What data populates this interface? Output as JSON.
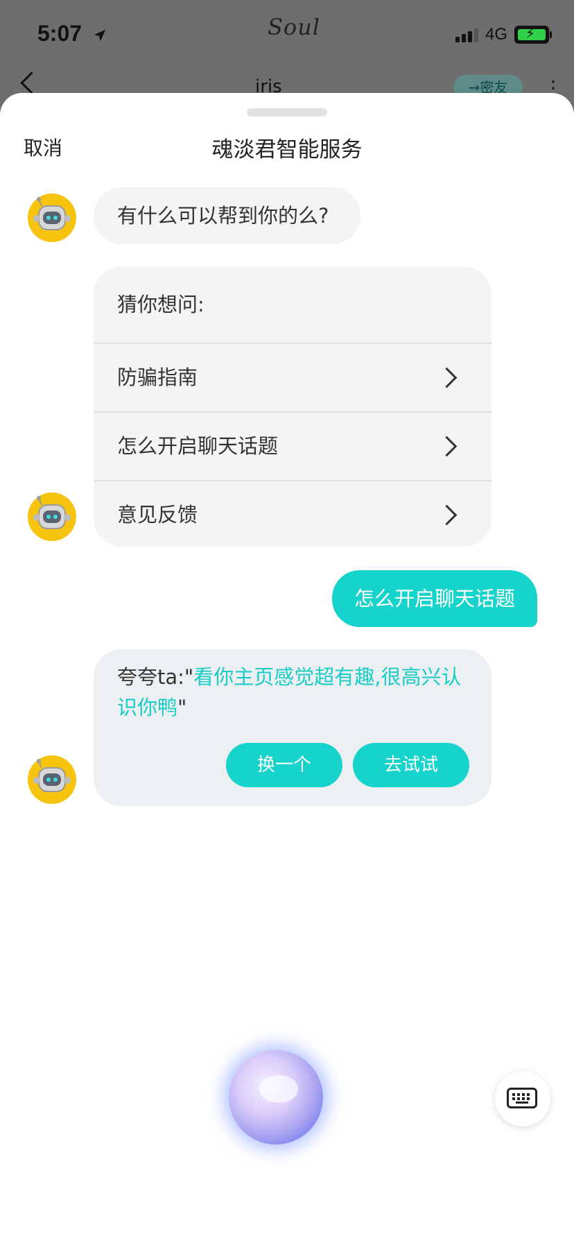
{
  "status_bar": {
    "time": "5:07",
    "network": "4G",
    "app_logo": "Soul"
  },
  "background_nav": {
    "name": "iris",
    "pill": "→密友"
  },
  "sheet": {
    "cancel_label": "取消",
    "title": "魂淡君智能服务"
  },
  "messages": {
    "greeting": "有什么可以帮到你的么?",
    "suggest_header": "猜你想问:",
    "suggestions": [
      {
        "label": "防骗指南"
      },
      {
        "label": "怎么开启聊天话题"
      },
      {
        "label": "意见反馈"
      }
    ],
    "user_message": "怎么开启聊天话题",
    "reply": {
      "prefix": "夸夸ta:\"",
      "highlight": "看你主页感觉超有趣,很高兴认识你鸭",
      "suffix": "\"",
      "swap_label": "换一个",
      "try_label": "去试试"
    }
  },
  "colors": {
    "accent": "#16d4cc",
    "bubble_gray": "#f4f4f4",
    "reply_bg": "#edf0f3"
  },
  "icons": {
    "avatar": "robot-avatar-icon",
    "keyboard": "keyboard-icon",
    "voice": "voice-orb-icon"
  }
}
